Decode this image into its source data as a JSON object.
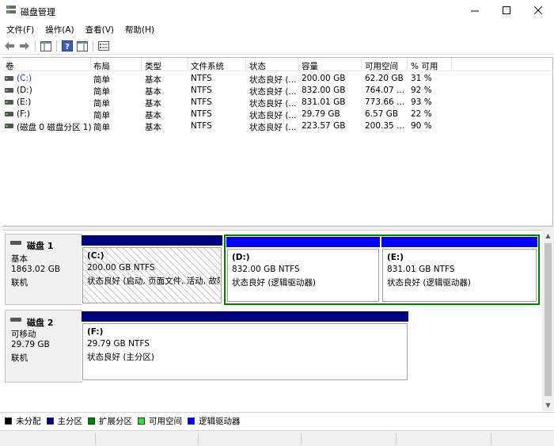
{
  "window": {
    "title": "磁盘管理"
  },
  "menu": [
    "文件(F)",
    "操作(A)",
    "查看(V)",
    "帮助(H)"
  ],
  "columns": [
    "卷",
    "布局",
    "类型",
    "文件系统",
    "状态",
    "容量",
    "可用空间",
    "% 可用"
  ],
  "volumes": [
    {
      "name": "(C:)",
      "layout": "简单",
      "type": "基本",
      "fs": "NTFS",
      "status": "状态良好 (...",
      "capacity": "200.00 GB",
      "free": "62.20 GB",
      "pct": "31 %"
    },
    {
      "name": "(D:)",
      "layout": "简单",
      "type": "基本",
      "fs": "NTFS",
      "status": "状态良好 (...",
      "capacity": "832.00 GB",
      "free": "764.07 ...",
      "pct": "92 %"
    },
    {
      "name": "(E:)",
      "layout": "简单",
      "type": "基本",
      "fs": "NTFS",
      "status": "状态良好 (...",
      "capacity": "831.01 GB",
      "free": "773.66 ...",
      "pct": "93 %"
    },
    {
      "name": "(F:)",
      "layout": "简单",
      "type": "基本",
      "fs": "NTFS",
      "status": "状态良好 (...",
      "capacity": "29.79 GB",
      "free": "6.57 GB",
      "pct": "22 %"
    },
    {
      "name": "(磁盘 0 磁盘分区 1)",
      "layout": "简单",
      "type": "基本",
      "fs": "NTFS",
      "status": "状态良好 (...",
      "capacity": "223.57 GB",
      "free": "200.35 ...",
      "pct": "90 %"
    }
  ],
  "disks": [
    {
      "name": "磁盘 1",
      "type": "基本",
      "size": "1863.02 GB",
      "state": "联机",
      "partitions": [
        {
          "label": "(C:)",
          "size": "200.00 GB NTFS",
          "status": "状态良好 (启动, 页面文件, 活动, 故障"
        },
        {
          "label": "(D:)",
          "size": "832.00 GB NTFS",
          "status": "状态良好 (逻辑驱动器)"
        },
        {
          "label": "(E:)",
          "size": "831.01 GB NTFS",
          "status": "状态良好 (逻辑驱动器)"
        }
      ]
    },
    {
      "name": "磁盘 2",
      "type": "可移动",
      "size": "29.79 GB",
      "state": "联机",
      "partitions": [
        {
          "label": "(F:)",
          "size": "29.79 GB NTFS",
          "status": "状态良好 (主分区)"
        }
      ]
    }
  ],
  "legend": [
    {
      "label": "未分配",
      "color": "#000000"
    },
    {
      "label": "主分区",
      "color": "#000080"
    },
    {
      "label": "扩展分区",
      "color": "#008000"
    },
    {
      "label": "可用空间",
      "color": "#33dd33"
    },
    {
      "label": "逻辑驱动器",
      "color": "#0000ff"
    }
  ],
  "colors": {
    "primary_bar": "#000080",
    "logical_bar": "#0000ff",
    "extended_border": "#008000"
  }
}
